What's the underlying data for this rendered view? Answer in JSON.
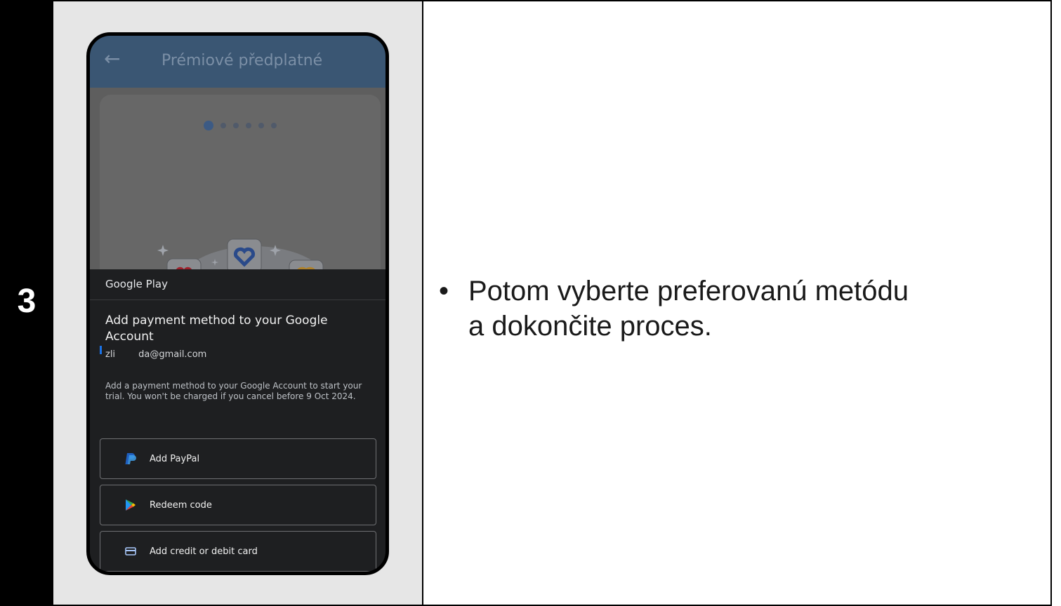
{
  "step": {
    "number": "3"
  },
  "phone": {
    "app_bar": {
      "back_icon": "arrow-left-icon",
      "title": "Prémiové předplatné"
    },
    "carousel": {
      "page_count": 6,
      "active_index": 0
    },
    "sheet": {
      "header": "Google Play",
      "title": "Add payment method to your Google Account",
      "email": "zli        da@gmail.com",
      "description": "Add a payment method to your Google Account to start your trial. You won't be charged if you cancel before 9 Oct 2024.",
      "options": [
        {
          "label": "Add PayPal",
          "icon": "paypal-icon"
        },
        {
          "label": "Redeem code",
          "icon": "google-play-icon"
        },
        {
          "label": "Add credit or debit card",
          "icon": "credit-card-icon"
        }
      ]
    }
  },
  "instruction": {
    "bullet": "•",
    "line1": "Potom vyberte preferovanú metódu",
    "line2": "a dokončite proces."
  },
  "colors": {
    "app_bar": "#3a5673",
    "sheet_background": "#1e1f21",
    "account_marker": "#1a73e8"
  }
}
